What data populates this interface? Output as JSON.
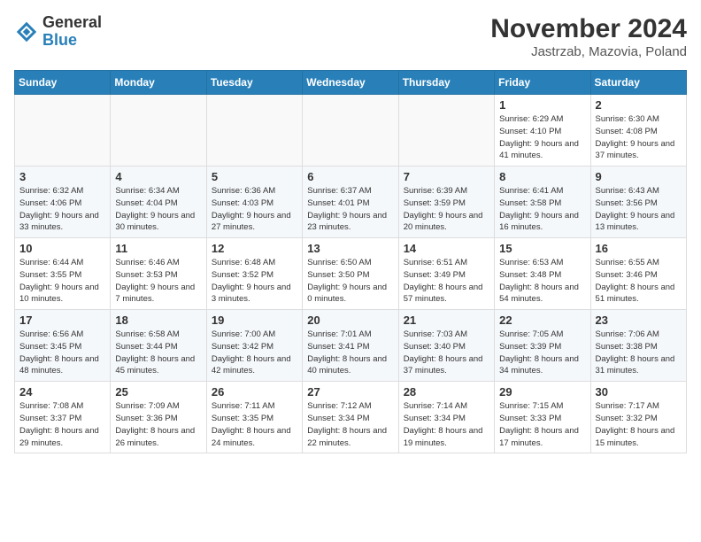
{
  "logo": {
    "general": "General",
    "blue": "Blue"
  },
  "title": "November 2024",
  "subtitle": "Jastrzab, Mazovia, Poland",
  "weekdays": [
    "Sunday",
    "Monday",
    "Tuesday",
    "Wednesday",
    "Thursday",
    "Friday",
    "Saturday"
  ],
  "weeks": [
    [
      {
        "day": "",
        "info": ""
      },
      {
        "day": "",
        "info": ""
      },
      {
        "day": "",
        "info": ""
      },
      {
        "day": "",
        "info": ""
      },
      {
        "day": "",
        "info": ""
      },
      {
        "day": "1",
        "info": "Sunrise: 6:29 AM\nSunset: 4:10 PM\nDaylight: 9 hours and 41 minutes."
      },
      {
        "day": "2",
        "info": "Sunrise: 6:30 AM\nSunset: 4:08 PM\nDaylight: 9 hours and 37 minutes."
      }
    ],
    [
      {
        "day": "3",
        "info": "Sunrise: 6:32 AM\nSunset: 4:06 PM\nDaylight: 9 hours and 33 minutes."
      },
      {
        "day": "4",
        "info": "Sunrise: 6:34 AM\nSunset: 4:04 PM\nDaylight: 9 hours and 30 minutes."
      },
      {
        "day": "5",
        "info": "Sunrise: 6:36 AM\nSunset: 4:03 PM\nDaylight: 9 hours and 27 minutes."
      },
      {
        "day": "6",
        "info": "Sunrise: 6:37 AM\nSunset: 4:01 PM\nDaylight: 9 hours and 23 minutes."
      },
      {
        "day": "7",
        "info": "Sunrise: 6:39 AM\nSunset: 3:59 PM\nDaylight: 9 hours and 20 minutes."
      },
      {
        "day": "8",
        "info": "Sunrise: 6:41 AM\nSunset: 3:58 PM\nDaylight: 9 hours and 16 minutes."
      },
      {
        "day": "9",
        "info": "Sunrise: 6:43 AM\nSunset: 3:56 PM\nDaylight: 9 hours and 13 minutes."
      }
    ],
    [
      {
        "day": "10",
        "info": "Sunrise: 6:44 AM\nSunset: 3:55 PM\nDaylight: 9 hours and 10 minutes."
      },
      {
        "day": "11",
        "info": "Sunrise: 6:46 AM\nSunset: 3:53 PM\nDaylight: 9 hours and 7 minutes."
      },
      {
        "day": "12",
        "info": "Sunrise: 6:48 AM\nSunset: 3:52 PM\nDaylight: 9 hours and 3 minutes."
      },
      {
        "day": "13",
        "info": "Sunrise: 6:50 AM\nSunset: 3:50 PM\nDaylight: 9 hours and 0 minutes."
      },
      {
        "day": "14",
        "info": "Sunrise: 6:51 AM\nSunset: 3:49 PM\nDaylight: 8 hours and 57 minutes."
      },
      {
        "day": "15",
        "info": "Sunrise: 6:53 AM\nSunset: 3:48 PM\nDaylight: 8 hours and 54 minutes."
      },
      {
        "day": "16",
        "info": "Sunrise: 6:55 AM\nSunset: 3:46 PM\nDaylight: 8 hours and 51 minutes."
      }
    ],
    [
      {
        "day": "17",
        "info": "Sunrise: 6:56 AM\nSunset: 3:45 PM\nDaylight: 8 hours and 48 minutes."
      },
      {
        "day": "18",
        "info": "Sunrise: 6:58 AM\nSunset: 3:44 PM\nDaylight: 8 hours and 45 minutes."
      },
      {
        "day": "19",
        "info": "Sunrise: 7:00 AM\nSunset: 3:42 PM\nDaylight: 8 hours and 42 minutes."
      },
      {
        "day": "20",
        "info": "Sunrise: 7:01 AM\nSunset: 3:41 PM\nDaylight: 8 hours and 40 minutes."
      },
      {
        "day": "21",
        "info": "Sunrise: 7:03 AM\nSunset: 3:40 PM\nDaylight: 8 hours and 37 minutes."
      },
      {
        "day": "22",
        "info": "Sunrise: 7:05 AM\nSunset: 3:39 PM\nDaylight: 8 hours and 34 minutes."
      },
      {
        "day": "23",
        "info": "Sunrise: 7:06 AM\nSunset: 3:38 PM\nDaylight: 8 hours and 31 minutes."
      }
    ],
    [
      {
        "day": "24",
        "info": "Sunrise: 7:08 AM\nSunset: 3:37 PM\nDaylight: 8 hours and 29 minutes."
      },
      {
        "day": "25",
        "info": "Sunrise: 7:09 AM\nSunset: 3:36 PM\nDaylight: 8 hours and 26 minutes."
      },
      {
        "day": "26",
        "info": "Sunrise: 7:11 AM\nSunset: 3:35 PM\nDaylight: 8 hours and 24 minutes."
      },
      {
        "day": "27",
        "info": "Sunrise: 7:12 AM\nSunset: 3:34 PM\nDaylight: 8 hours and 22 minutes."
      },
      {
        "day": "28",
        "info": "Sunrise: 7:14 AM\nSunset: 3:34 PM\nDaylight: 8 hours and 19 minutes."
      },
      {
        "day": "29",
        "info": "Sunrise: 7:15 AM\nSunset: 3:33 PM\nDaylight: 8 hours and 17 minutes."
      },
      {
        "day": "30",
        "info": "Sunrise: 7:17 AM\nSunset: 3:32 PM\nDaylight: 8 hours and 15 minutes."
      }
    ]
  ]
}
